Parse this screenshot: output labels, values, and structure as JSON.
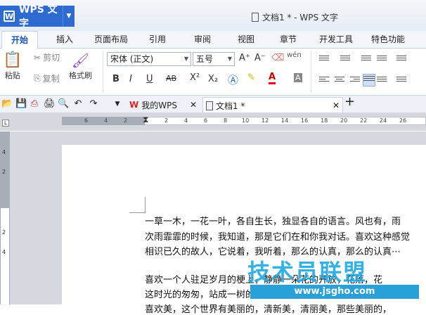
{
  "app": {
    "name": "WPS 文字",
    "logo": "W",
    "doc_title": "文档1 * - WPS 文字"
  },
  "tabs": [
    "开始",
    "插入",
    "页面布局",
    "引用",
    "审阅",
    "视图",
    "章节",
    "开发工具",
    "特色功能"
  ],
  "ribbon": {
    "paste": "粘贴",
    "cut": "剪切",
    "copy": "复制",
    "format_painter": "格式刷",
    "font_name": "宋体 (正文)",
    "font_size": "五号",
    "bold": "B",
    "italic": "I",
    "underline": "U",
    "strike": "AB",
    "superscript": "X²",
    "subscript": "X₂",
    "grow": "A⁺",
    "shrink": "A⁻",
    "pinyin": "wén",
    "font_color": "A",
    "char_shade": "A"
  },
  "doc_tabs": [
    {
      "label": "我的WPS"
    },
    {
      "label": "文档1 *"
    }
  ],
  "ruler": {
    "numbers": [
      "6",
      "4",
      "2",
      "2",
      "4",
      "6",
      "8",
      "10",
      "12",
      "14",
      "16",
      "18",
      "20",
      "22",
      "24",
      "26"
    ]
  },
  "vruler": {
    "numbers": [
      "4",
      "2",
      "2",
      "4"
    ]
  },
  "document": {
    "lines": [
      "一草一木，一花一叶，各自生长，独显各自的语言。风也有，雨",
      "次雨霏霏的时候，我知道，那是它们在和你我对话。喜欢这种感觉",
      "相识已久的故人，它说着，我听着，那么的认真，那么的认真⋯",
      "喜欢一个人驻足岁月的梗上，静静一朵花的开放，花落，花",
      "这时光的匆匆，站成一树的风景，看着日子一天天的远去，年轻扬",
      "喜欢美，这个世界有美丽的，清新美，清丽美，那些美丽的，"
    ]
  },
  "watermark": {
    "title": "技术员联盟",
    "url": "www.jsgho.com"
  }
}
